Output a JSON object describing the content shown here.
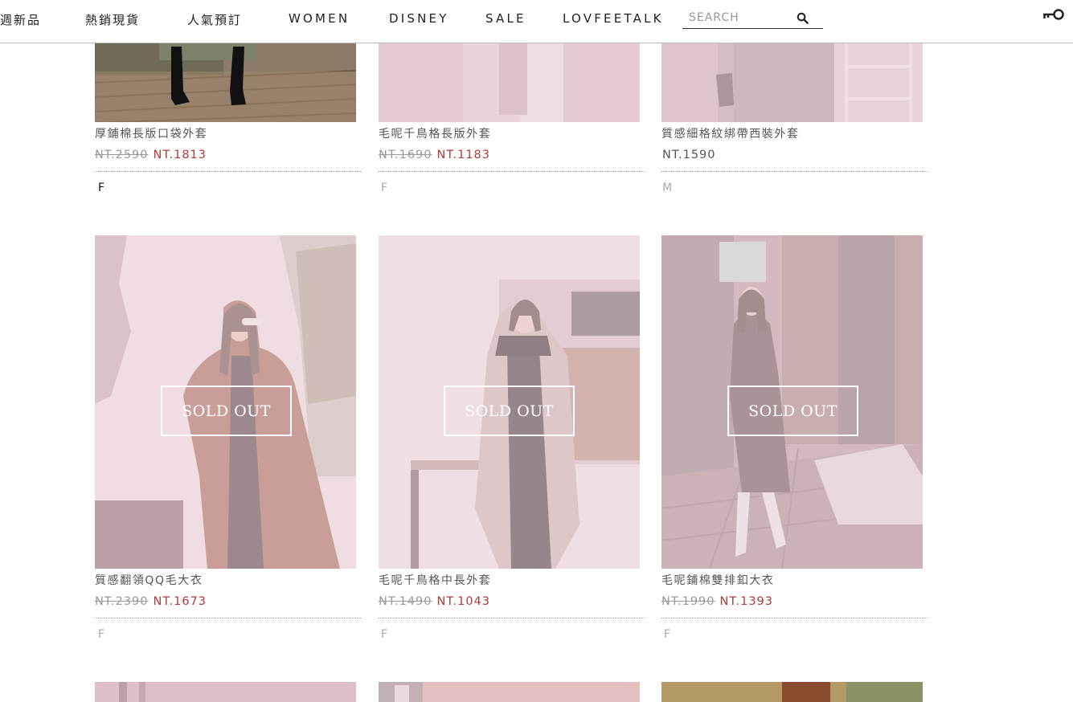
{
  "nav": {
    "items": [
      "週新品",
      "熱銷現貨",
      "人氣預訂",
      "WOMEN",
      "DISNEY",
      "SALE",
      "LOVFEETALK"
    ],
    "search_placeholder": "SEARCH",
    "search_icon": "search-icon",
    "member_icon": "key-icon"
  },
  "products": [
    {
      "name": "厚鋪棉長版口袋外套",
      "old_price": "NT.2590",
      "price": "NT.1813",
      "sizes": [
        "F"
      ],
      "sold_out": false
    },
    {
      "name": "毛呢千鳥格長版外套",
      "old_price": "NT.1690",
      "price": "NT.1183",
      "sizes": [
        "F"
      ],
      "sold_out": false
    },
    {
      "name": "質感細格紋綁帶西裝外套",
      "old_price": "",
      "price": "NT.1590",
      "sizes": [
        "M"
      ],
      "sold_out": false
    },
    {
      "name": "質感翻領QQ毛大衣",
      "old_price": "NT.2390",
      "price": "NT.1673",
      "sizes": [
        "F"
      ],
      "sold_out": true
    },
    {
      "name": "毛呢千鳥格中長外套",
      "old_price": "NT.1490",
      "price": "NT.1043",
      "sizes": [
        "F"
      ],
      "sold_out": true
    },
    {
      "name": "毛呢鋪棉雙排釦大衣",
      "old_price": "NT.1990",
      "price": "NT.1393",
      "sizes": [
        "F"
      ],
      "sold_out": true
    }
  ],
  "sold_out_label": "SOLD OUT",
  "colors": {
    "sale_price": "#b23a3a",
    "overlay": "#ecd6dc"
  }
}
